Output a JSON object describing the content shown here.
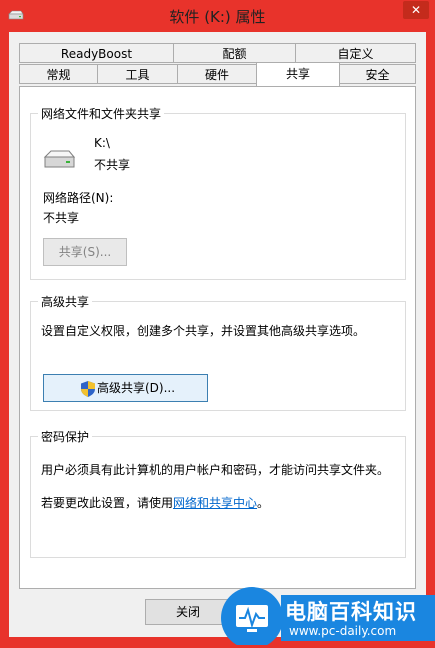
{
  "window": {
    "title": "软件 (K:) 属性",
    "close_glyph": "✕"
  },
  "tabs_row1": [
    "ReadyBoost",
    "配额",
    "自定义"
  ],
  "tabs_row2": [
    "常规",
    "工具",
    "硬件",
    "共享",
    "安全"
  ],
  "active_tab": "共享",
  "network_share": {
    "group_title": "网络文件和文件夹共享",
    "drive_path": "K:\\",
    "drive_status": "不共享",
    "network_path_label": "网络路径(N):",
    "network_path_value": "不共享",
    "share_button": "共享(S)..."
  },
  "advanced_share": {
    "group_title": "高级共享",
    "description": "设置自定义权限，创建多个共享，并设置其他高级共享选项。",
    "button": "高级共享(D)..."
  },
  "password_protection": {
    "group_title": "密码保护",
    "description": "用户必须具有此计算机的用户帐户和密码，才能访问共享文件夹。",
    "change_prefix": "若要更改此设置，请使用",
    "link": "网络和共享中心",
    "change_suffix": "。"
  },
  "footer": {
    "close_button": "关闭"
  },
  "watermark": {
    "brand": "电脑百科知识",
    "url": "www.pc-daily.com"
  }
}
